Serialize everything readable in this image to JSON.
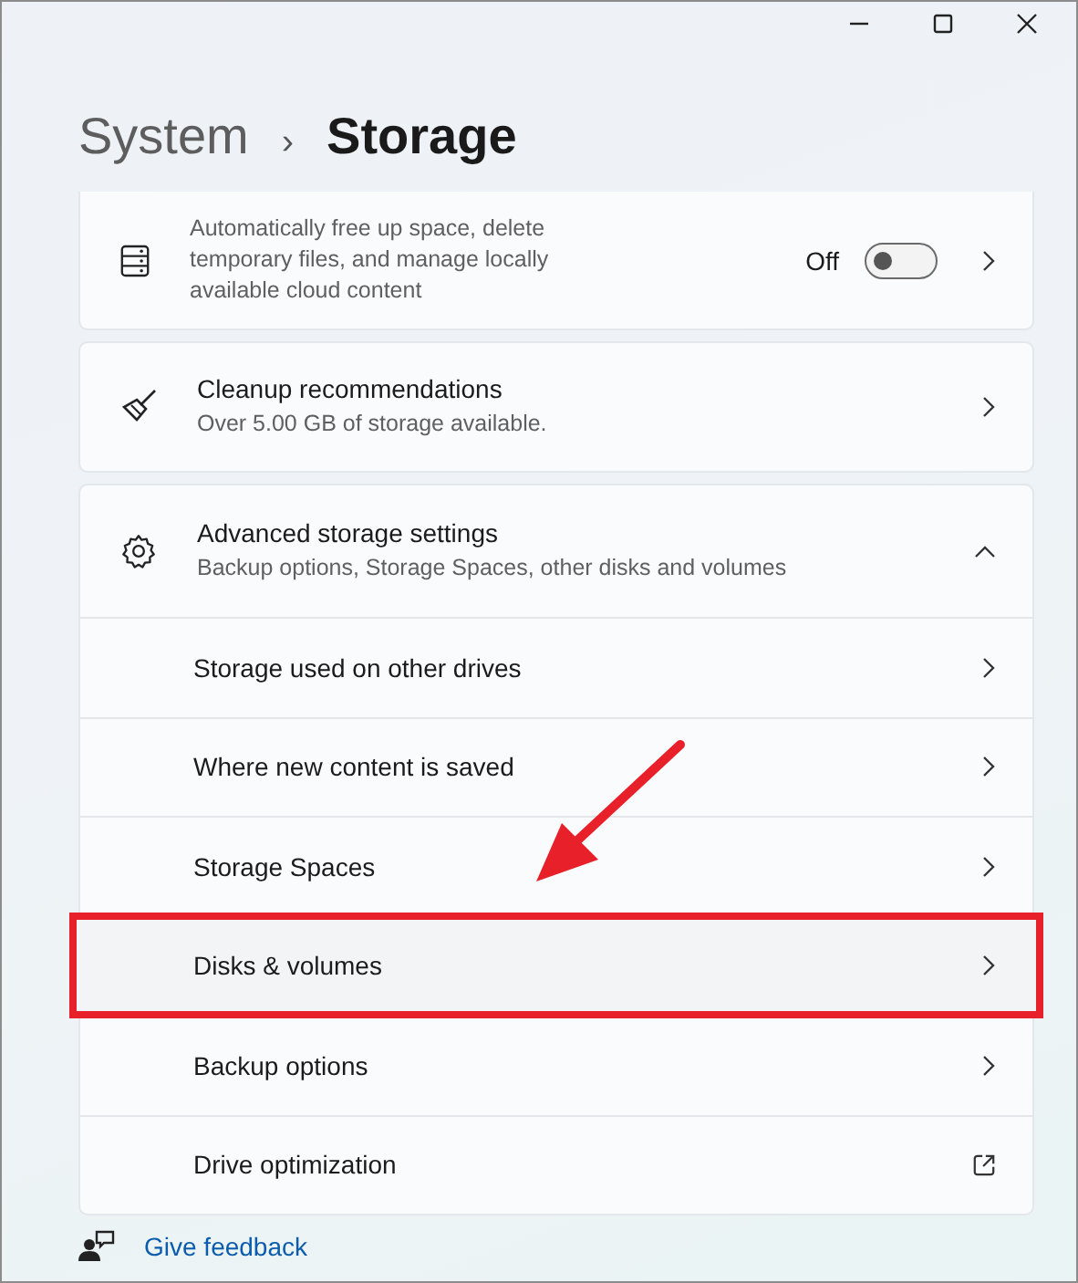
{
  "breadcrumb": {
    "parent": "System",
    "separator": "›",
    "current": "Storage"
  },
  "storage_sense": {
    "description": "Automatically free up space, delete temporary files, and manage locally available cloud content",
    "toggle_label": "Off",
    "on": false
  },
  "cleanup": {
    "title": "Cleanup recommendations",
    "description": "Over 5.00 GB of storage available."
  },
  "advanced": {
    "title": "Advanced storage settings",
    "description": "Backup options, Storage Spaces, other disks and volumes",
    "expanded": true,
    "items": [
      {
        "label": "Storage used on other drives",
        "kind": "nav",
        "highlighted": false
      },
      {
        "label": "Where new content is saved",
        "kind": "nav",
        "highlighted": false
      },
      {
        "label": "Storage Spaces",
        "kind": "nav",
        "highlighted": false
      },
      {
        "label": "Disks & volumes",
        "kind": "nav",
        "highlighted": true
      },
      {
        "label": "Backup options",
        "kind": "nav",
        "highlighted": false
      },
      {
        "label": "Drive optimization",
        "kind": "external",
        "highlighted": false
      }
    ]
  },
  "feedback": {
    "label": "Give feedback"
  }
}
